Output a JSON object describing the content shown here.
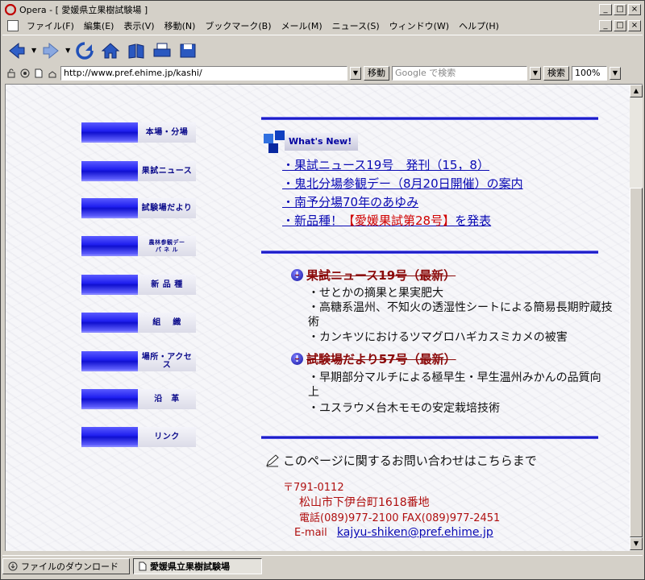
{
  "window": {
    "title": "Opera - [ 愛媛県立果樹試験場 ]",
    "min_label": "_",
    "max_label": "□",
    "close_label": "×"
  },
  "menu": [
    "ファイル(F)",
    "編集(E)",
    "表示(V)",
    "移動(N)",
    "ブックマーク(B)",
    "メール(M)",
    "ニュース(S)",
    "ウィンドウ(W)",
    "ヘルプ(H)"
  ],
  "address": {
    "url": "http://www.pref.ehime.jp/kashi/",
    "go_label": "移動",
    "search_placeholder": "Google で検索",
    "search_label": "検索",
    "zoom": "100%"
  },
  "nav": [
    "本場・分場",
    "果試ニュース",
    "試験場だより",
    "農林参観デー\nパ ネ ル",
    "新 品 種",
    "組　 織",
    "場所・アクセス",
    "沿　革",
    "リンク"
  ],
  "whats_new": {
    "label": "What's New!",
    "items": [
      {
        "text": "・果試ニュース19号　発刊（15，8）"
      },
      {
        "text": "・鬼北分場参観デー（8月20日開催）の案内"
      },
      {
        "text": "・南予分場70年のあゆみ"
      },
      {
        "pre": "・新品種！",
        "highlight": "【愛媛果試第28号】",
        "post": "を発表"
      }
    ]
  },
  "sections": [
    {
      "title": "果試ニュース19号（最新）",
      "bullets": [
        "・せとかの摘果と果実肥大",
        "・高糖系温州、不知火の透湿性シートによる簡易長期貯蔵技術",
        "・カンキツにおけるツマグロハギカスミカメの被害"
      ]
    },
    {
      "title": "試験場だより57号（最新）",
      "bullets": [
        "・早期部分マルチによる極早生・早生温州みかんの品質向上",
        "・ユスラウメ台木モモの安定栽培技術"
      ]
    }
  ],
  "contact": {
    "heading": "このページに関するお問い合わせはこちらまで",
    "postal": "〒791-0112",
    "address": "松山市下伊台町1618番地",
    "phone": "電話(089)977-2100 FAX(089)977-2451",
    "email_label": "E-mail",
    "email": "kajyu-shiken@pref.ehime.jp"
  },
  "status": {
    "downloads": "ファイルのダウンロード",
    "tab": "愛媛県立果樹試験場"
  },
  "colors": {
    "link": "#0a0ab4",
    "accent_blue": "#1010d0",
    "heading_red": "#8b0a0a"
  }
}
